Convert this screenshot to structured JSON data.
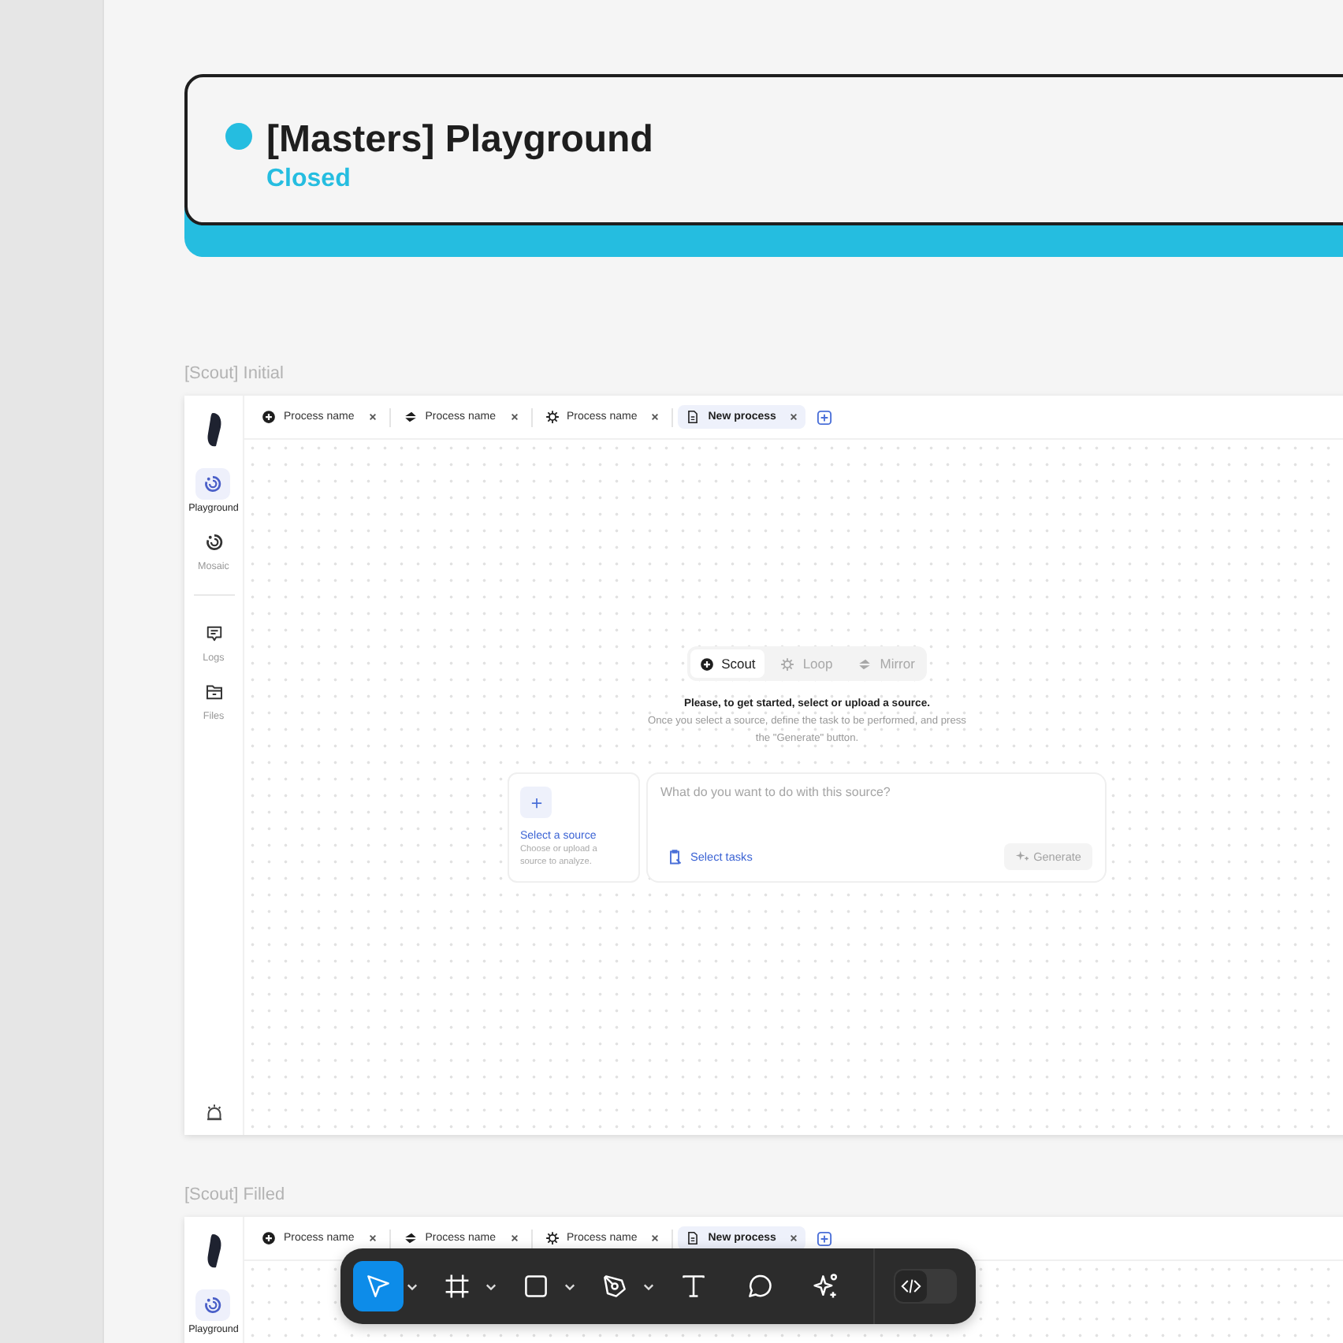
{
  "status_card": {
    "title": "[Masters] Playground",
    "status": "Closed",
    "color": "#25bde0"
  },
  "frames": [
    {
      "label": "[Scout] Initial",
      "tabs": [
        {
          "label": "Process name",
          "kind": "scout",
          "selected": false
        },
        {
          "label": "Process name",
          "kind": "mirror",
          "selected": false
        },
        {
          "label": "Process name",
          "kind": "loop",
          "selected": false
        },
        {
          "label": "New process",
          "kind": "document",
          "selected": true
        }
      ],
      "nav": [
        {
          "label": "Playground",
          "kind": "swirl",
          "selected": true
        },
        {
          "label": "Mosaic",
          "kind": "swirl",
          "selected": false
        }
      ],
      "nav_secondary": [
        {
          "label": "Logs",
          "kind": "chat",
          "selected": false
        },
        {
          "label": "Files",
          "kind": "folder",
          "selected": false
        }
      ],
      "modes": [
        {
          "label": "Scout",
          "kind": "scout",
          "selected": true
        },
        {
          "label": "Loop",
          "kind": "loop",
          "selected": false
        },
        {
          "label": "Mirror",
          "kind": "mirror",
          "selected": false
        }
      ],
      "heading": "Please, to get started, select or upload a source.",
      "description": "Once you select a source, define the task to be performed, and press the \"Generate\" button.",
      "source": {
        "title": "Select a source",
        "subtitle": "Choose or upload a source to analyze."
      },
      "prompt": {
        "placeholder": "What do you want to do with this source?"
      },
      "select_tasks": "Select tasks",
      "generate": {
        "label": "Generate",
        "disabled": true
      }
    },
    {
      "label": "[Scout] Filled",
      "tabs": [
        {
          "label": "Process name",
          "kind": "scout",
          "selected": false
        },
        {
          "label": "Process name",
          "kind": "mirror",
          "selected": false
        },
        {
          "label": "Process name",
          "kind": "loop",
          "selected": false
        },
        {
          "label": "New process",
          "kind": "document",
          "selected": true
        }
      ],
      "nav": [
        {
          "label": "Playground",
          "kind": "swirl",
          "selected": true
        }
      ]
    }
  ],
  "toolbar": {
    "tools": [
      {
        "kind": "move",
        "selected": true,
        "dropdown": true
      },
      {
        "kind": "frame",
        "selected": false,
        "dropdown": true
      },
      {
        "kind": "rectangle",
        "selected": false,
        "dropdown": true
      },
      {
        "kind": "pen",
        "selected": false,
        "dropdown": true
      },
      {
        "kind": "text",
        "selected": false,
        "dropdown": false
      },
      {
        "kind": "comment",
        "selected": false,
        "dropdown": false
      },
      {
        "kind": "ai",
        "selected": false,
        "dropdown": false
      }
    ],
    "dev_mode": {
      "on": false
    }
  }
}
